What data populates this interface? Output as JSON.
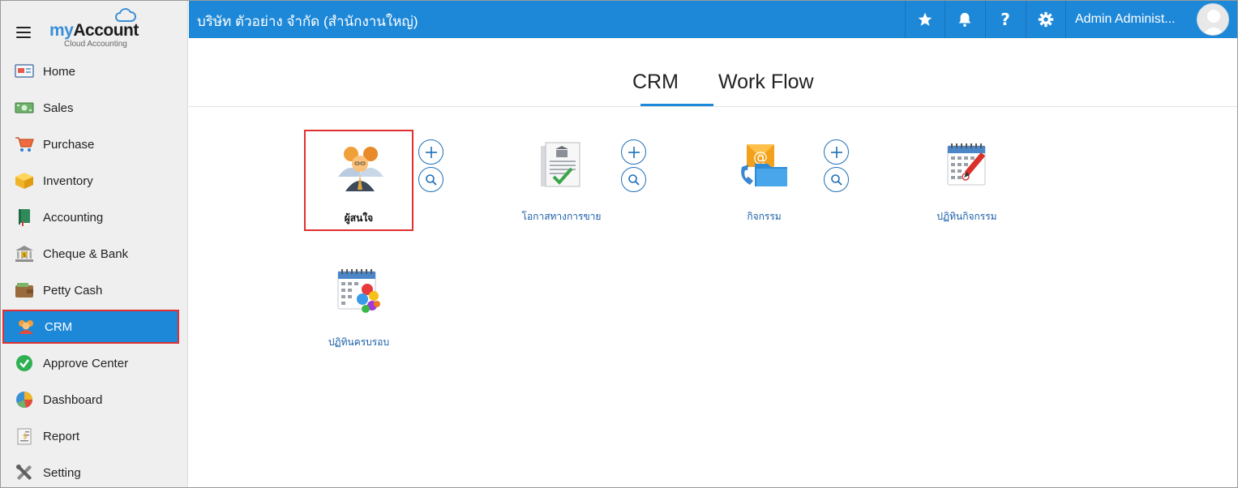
{
  "brand": {
    "name_part1": "my",
    "name_part2": "Account",
    "subtitle": "Cloud Accounting"
  },
  "sidebar": {
    "items": [
      {
        "label": "Home",
        "icon": "home-icon"
      },
      {
        "label": "Sales",
        "icon": "money-icon"
      },
      {
        "label": "Purchase",
        "icon": "cart-icon"
      },
      {
        "label": "Inventory",
        "icon": "box-icon"
      },
      {
        "label": "Accounting",
        "icon": "ledger-book-icon"
      },
      {
        "label": "Cheque & Bank",
        "icon": "bank-icon"
      },
      {
        "label": "Petty Cash",
        "icon": "wallet-icon"
      },
      {
        "label": "CRM",
        "icon": "crm-users-icon",
        "active": true
      },
      {
        "label": "Approve Center",
        "icon": "check-circle-icon"
      },
      {
        "label": "Dashboard",
        "icon": "pie-chart-icon"
      },
      {
        "label": "Report",
        "icon": "report-icon"
      },
      {
        "label": "Setting",
        "icon": "tools-icon"
      }
    ]
  },
  "header": {
    "company": "บริษัท ตัวอย่าง จำกัด (สำนักงานใหญ่)",
    "user": "Admin Administrator",
    "user_display": "Admin Administ...",
    "icons": [
      "star-icon",
      "bell-icon",
      "help-icon",
      "gear-icon"
    ]
  },
  "tabs": [
    {
      "label": "CRM",
      "active": true
    },
    {
      "label": "Work Flow",
      "active": false
    }
  ],
  "tiles": [
    {
      "label": "ผู้สนใจ",
      "icon": "contacts-people-icon",
      "selected": true,
      "actions": [
        "add",
        "search"
      ]
    },
    {
      "label": "โอกาสทางการขาย",
      "icon": "sales-opportunity-document-icon",
      "actions": [
        "add",
        "search"
      ]
    },
    {
      "label": "กิจกรรม",
      "icon": "activity-email-folder-icon",
      "actions": [
        "add",
        "search"
      ]
    },
    {
      "label": "ปฏิทินกิจกรรม",
      "icon": "activity-calendar-icon",
      "actions": []
    },
    {
      "label": "ปฏิทินครบรอบ",
      "icon": "anniversary-calendar-icon",
      "actions": []
    }
  ],
  "colors": {
    "primary": "#1e88d8",
    "highlight": "#e03030",
    "link": "#1a5ea8",
    "sidebar_bg": "#efefef"
  }
}
